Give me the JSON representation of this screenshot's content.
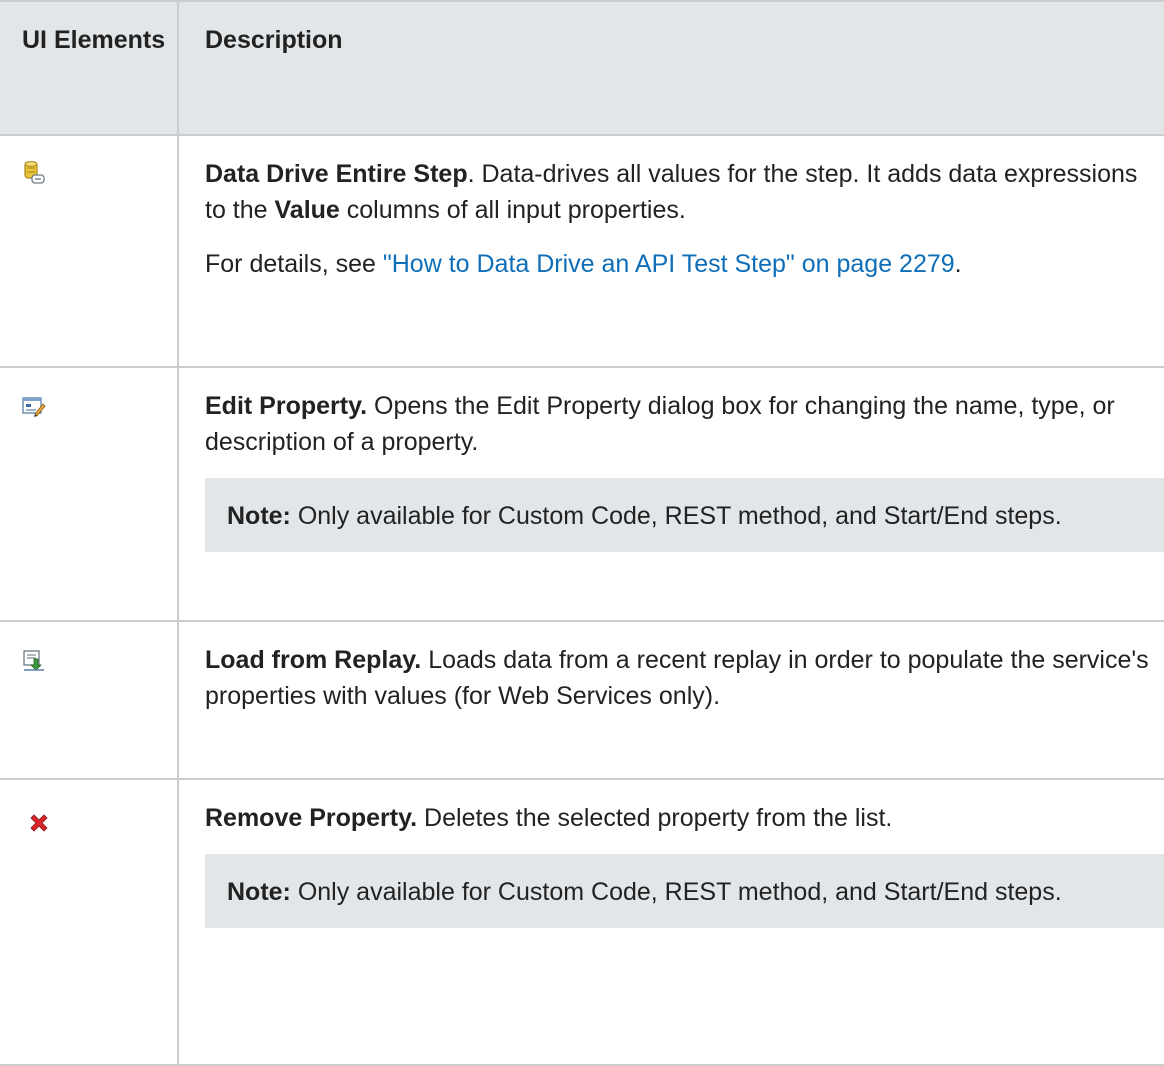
{
  "table": {
    "headers": {
      "ui_elements": "UI Elements",
      "description": "Description"
    },
    "rows": [
      {
        "icon": "data-drive-icon",
        "title": "Data Drive Entire Step",
        "title_suffix": ".",
        "text_1": " Data-drives all values for the step. It adds data expressions to the ",
        "bold_value": "Value",
        "text_2": " columns of all input properties.",
        "details_prefix": "For details, see ",
        "link_text": "\"How to Data Drive an API Test Step\" on page 2279",
        "details_suffix": "."
      },
      {
        "icon": "edit-property-icon",
        "title": "Edit Property.",
        "text": " Opens the Edit Property dialog box for changing the name, type, or description of a property.",
        "note_label": "Note:",
        "note_text": " Only available for Custom Code, REST method, and Start/End steps."
      },
      {
        "icon": "load-from-replay-icon",
        "title": "Load from Replay.",
        "text": " Loads data from a recent replay in order to populate the service's properties with values (for Web Services only)."
      },
      {
        "icon": "remove-property-icon",
        "title": "Remove Property.",
        "text": " Deletes the selected property from the list.",
        "note_label": "Note:",
        "note_text": " Only available for Custom Code, REST method, and Start/End steps."
      }
    ]
  },
  "colors": {
    "header_bg": "#e3e6e8",
    "border": "#cccccc",
    "link": "#0f6eb8",
    "note_bg": "#e3e6e8",
    "remove_icon": "#d9262c"
  }
}
